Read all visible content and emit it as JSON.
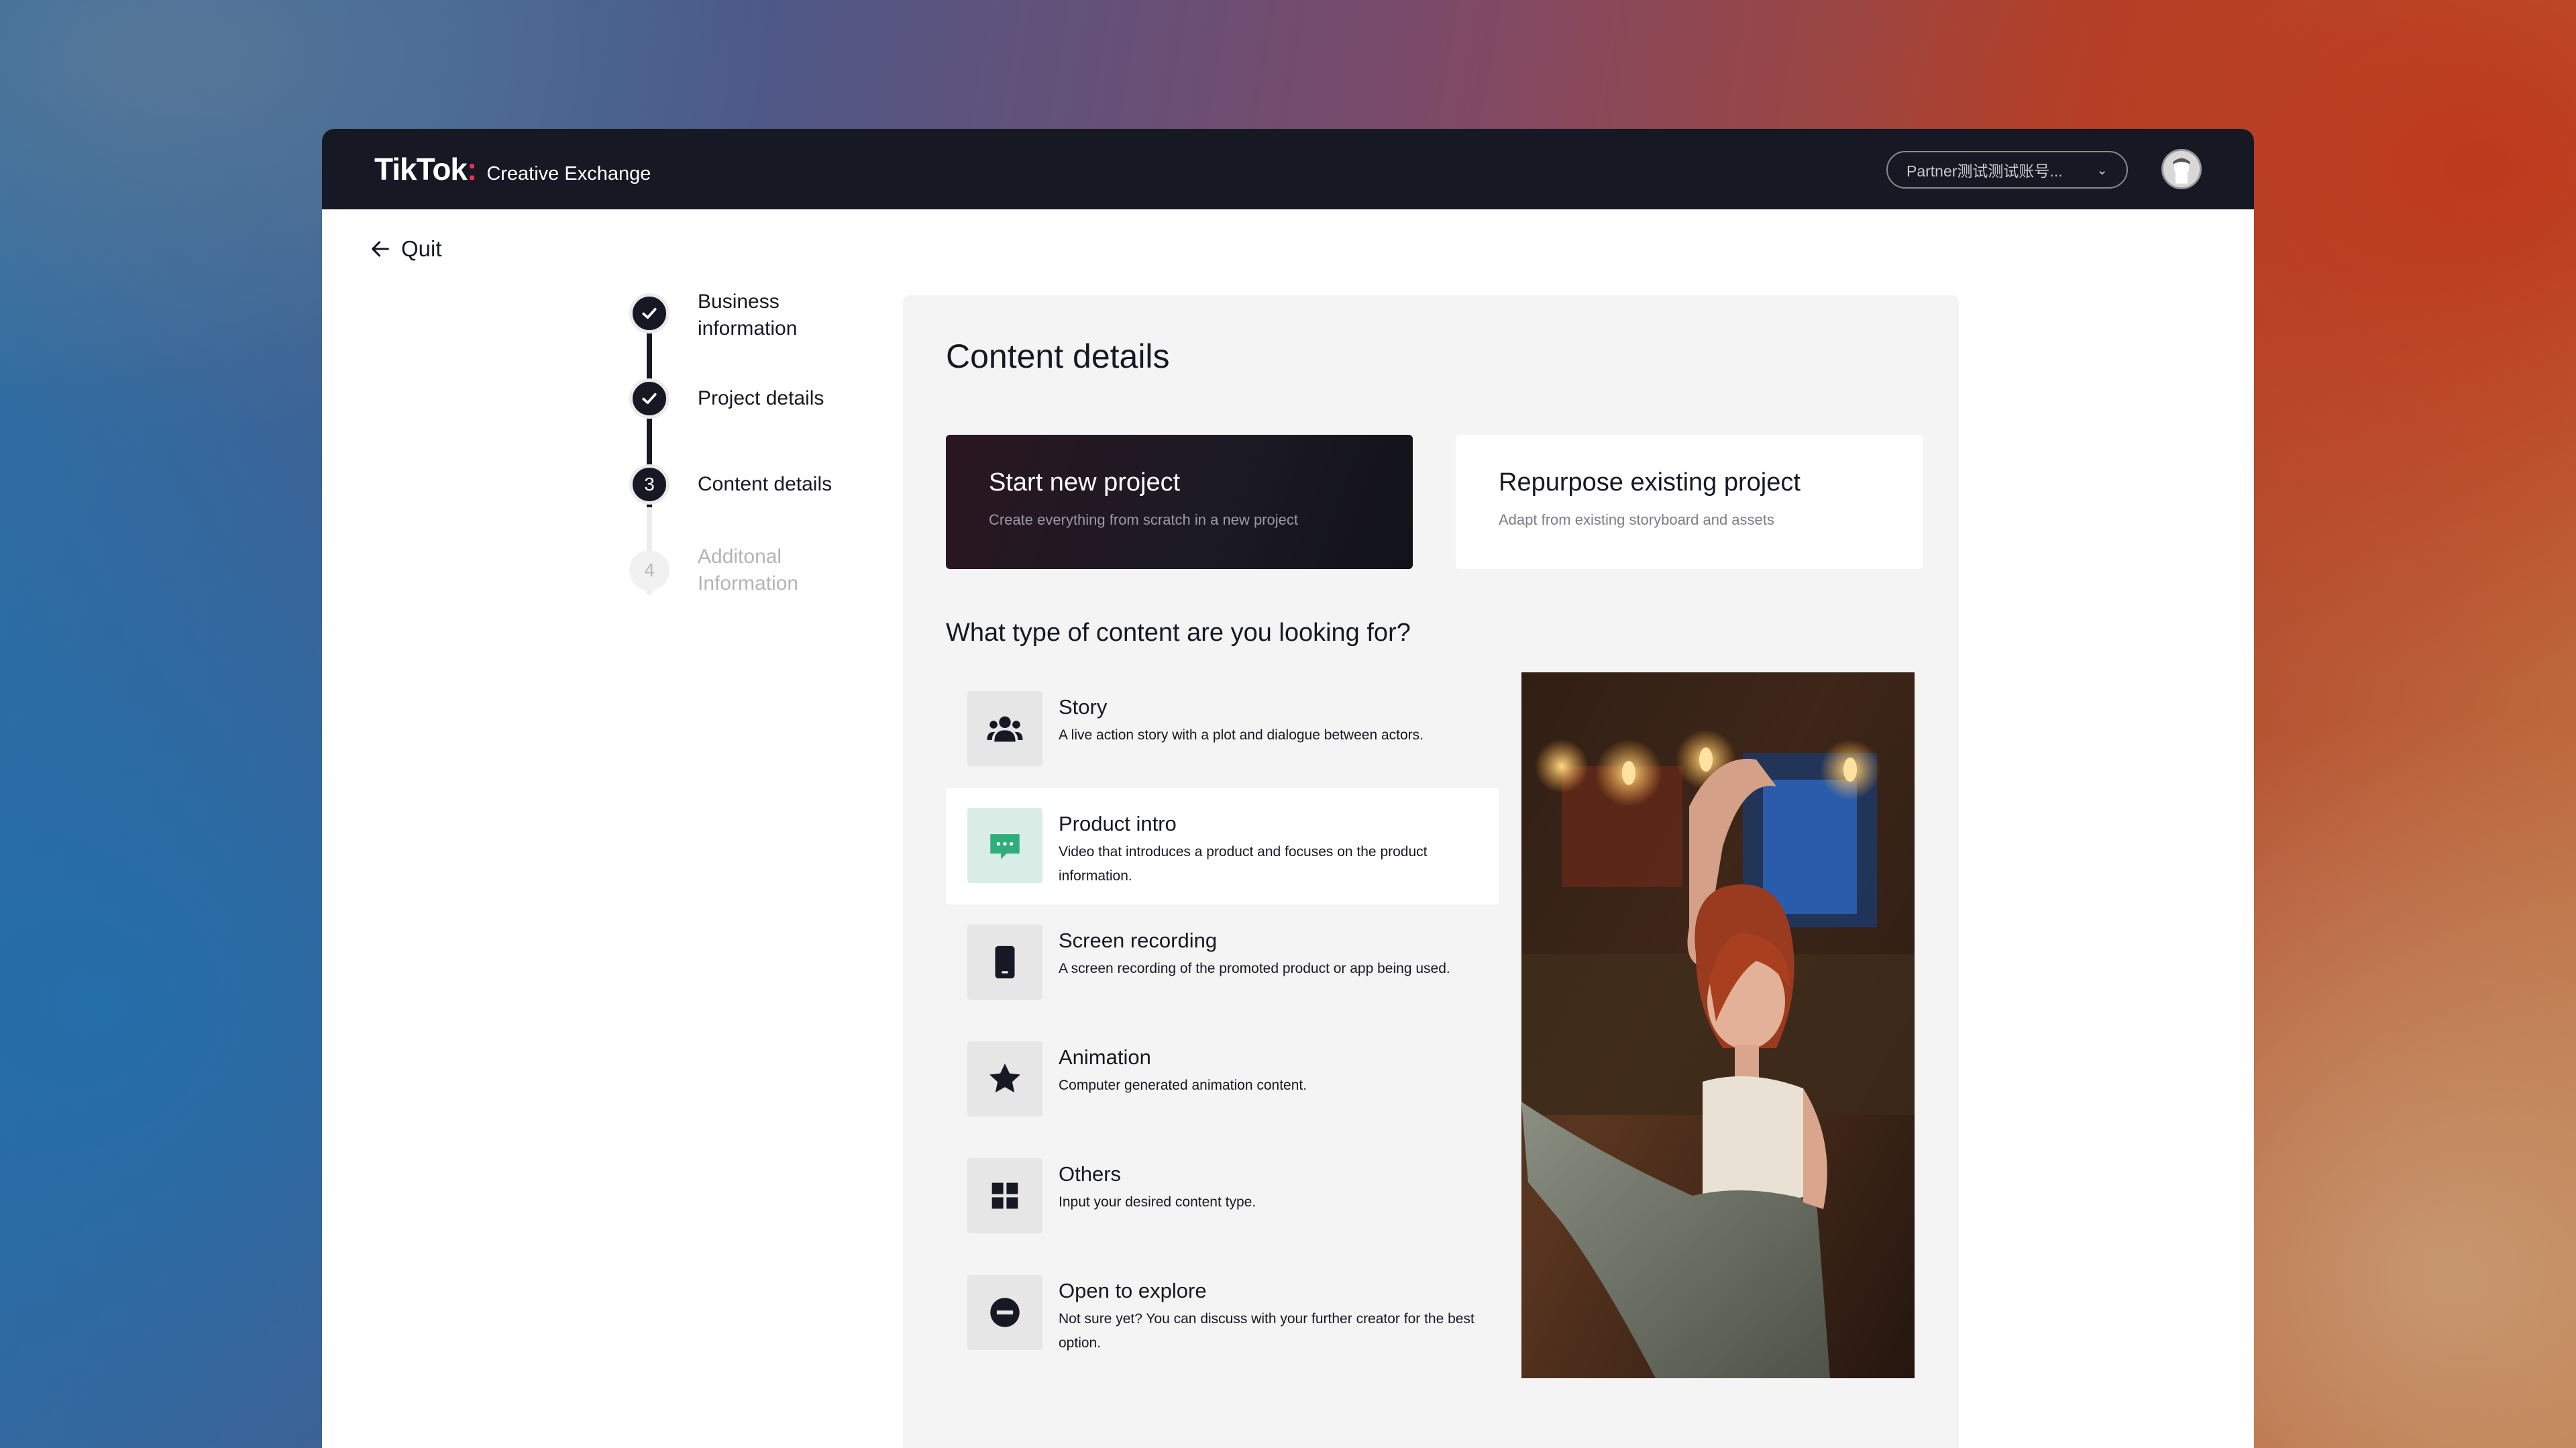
{
  "header": {
    "brand": "TikTok",
    "brand_sub": "Creative Exchange",
    "account_label": "Partner测试测试账号...",
    "colors": {
      "topbar": "#161823",
      "accent": "#fe2c55"
    }
  },
  "nav": {
    "quit_label": "Quit"
  },
  "stepper": {
    "steps": [
      {
        "number": "1",
        "label": "Business information",
        "status": "done"
      },
      {
        "number": "2",
        "label": "Project details",
        "status": "done"
      },
      {
        "number": "3",
        "label": "Content details",
        "status": "current"
      },
      {
        "number": "4",
        "label": "Additonal Information",
        "status": "todo"
      }
    ]
  },
  "main": {
    "title": "Content details",
    "options": [
      {
        "title": "Start new project",
        "subtitle": "Create everything from scratch in a new project",
        "selected": true
      },
      {
        "title": "Repurpose existing project",
        "subtitle": "Adapt from existing storyboard and assets",
        "selected": false
      }
    ],
    "question": "What type of content are you looking for?",
    "content_types": [
      {
        "icon": "people-icon",
        "title": "Story",
        "description": "A live action story with a plot and dialogue between actors."
      },
      {
        "icon": "chat-bubble-icon",
        "title": "Product intro",
        "description": "Video that introduces a product and focuses on the product information.",
        "selected": true
      },
      {
        "icon": "phone-icon",
        "title": "Screen recording",
        "description": "A screen recording of the promoted product or app being used."
      },
      {
        "icon": "star-icon",
        "title": "Animation",
        "description": "Computer generated animation content."
      },
      {
        "icon": "grid-icon",
        "title": "Others",
        "description": "Input your desired content type."
      },
      {
        "icon": "minus-circle-icon",
        "title": "Open to explore",
        "description": "Not sure yet? You can discuss with your further creator for the best option."
      }
    ]
  }
}
